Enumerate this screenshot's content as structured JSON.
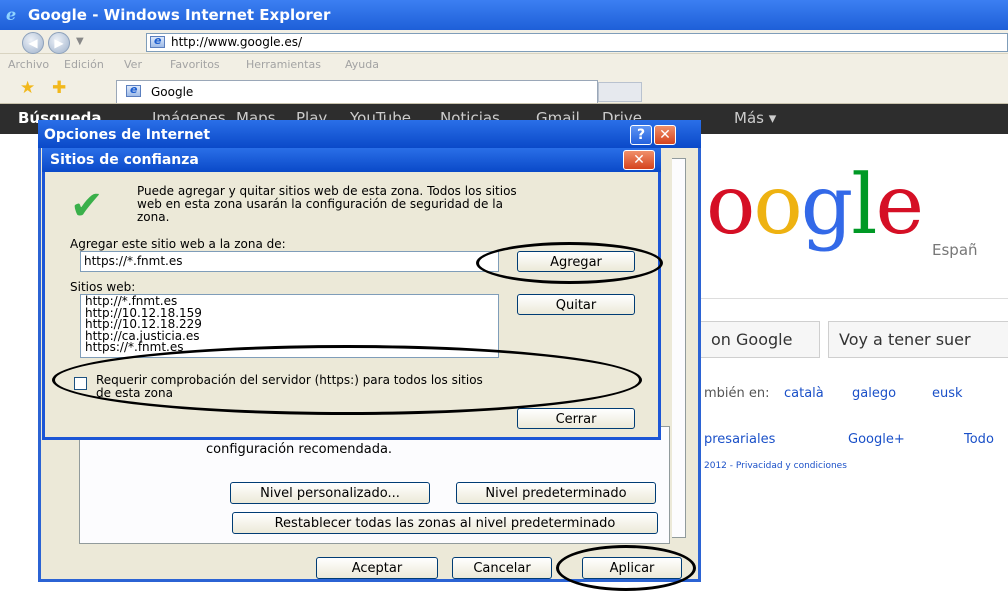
{
  "browser": {
    "window_title": "Google - Windows Internet Explorer",
    "url": "http://www.google.es/",
    "menu": [
      "Archivo",
      "Edición",
      "Ver",
      "Favoritos",
      "Herramientas",
      "Ayuda"
    ],
    "tab_title": "Google"
  },
  "google_page": {
    "nav_bar": [
      "Búsqueda",
      "Imágenes",
      "Maps",
      "Play",
      "YouTube",
      "Noticias",
      "Gmail",
      "Drive",
      "Más ▾"
    ],
    "logo_visible": "oogle",
    "logo_sub": "Españ",
    "search_button": "on Google",
    "lucky_button": "Voy a tener suer",
    "offered_in_label": "mbién en:",
    "offered_langs": [
      "català",
      "galego",
      "eusk"
    ],
    "footer_links": [
      "presariales",
      "Google+",
      "Todo"
    ],
    "copyright": "2012 - Privacidad y condiciones"
  },
  "internet_options": {
    "title": "Opciones de Internet",
    "help_button": "?",
    "close_button": "✕",
    "recommended_text": "configuración recomendada.",
    "custom_level_button": "Nivel personalizado...",
    "default_level_button": "Nivel predeterminado",
    "reset_all_button": "Restablecer todas las zonas al nivel predeterminado",
    "accept_button": "Aceptar",
    "cancel_button": "Cancelar",
    "apply_button": "Aplicar"
  },
  "trusted_sites": {
    "title": "Sitios de confianza",
    "close_button": "✕",
    "description_lines": [
      "Puede agregar y quitar sitios web de esta zona. Todos los sitios",
      "web en esta zona usarán la configuración de seguridad de la",
      "zona."
    ],
    "add_label": "Agregar este sitio web a la zona de:",
    "add_input_value": "https://*.fnmt.es",
    "add_button": "Agregar",
    "sites_label": "Sitios web:",
    "sites": [
      "http://*.fnmt.es",
      "http://10.12.18.159",
      "http://10.12.18.229",
      "http://ca.justicia.es",
      "https://*.fnmt.es"
    ],
    "remove_button": "Quitar",
    "require_https_lines": [
      "Requerir comprobación del servidor (https:) para todos los sitios",
      "de esta zona"
    ],
    "require_https_checked": false,
    "close_dialog_button": "Cerrar"
  },
  "colors": {
    "title_bar_blue": "#0a49c8",
    "xp_face": "#ece9d8",
    "google_blue": "#3369e8",
    "google_red": "#d50f25",
    "google_yellow": "#eeb211",
    "google_green": "#009925"
  }
}
